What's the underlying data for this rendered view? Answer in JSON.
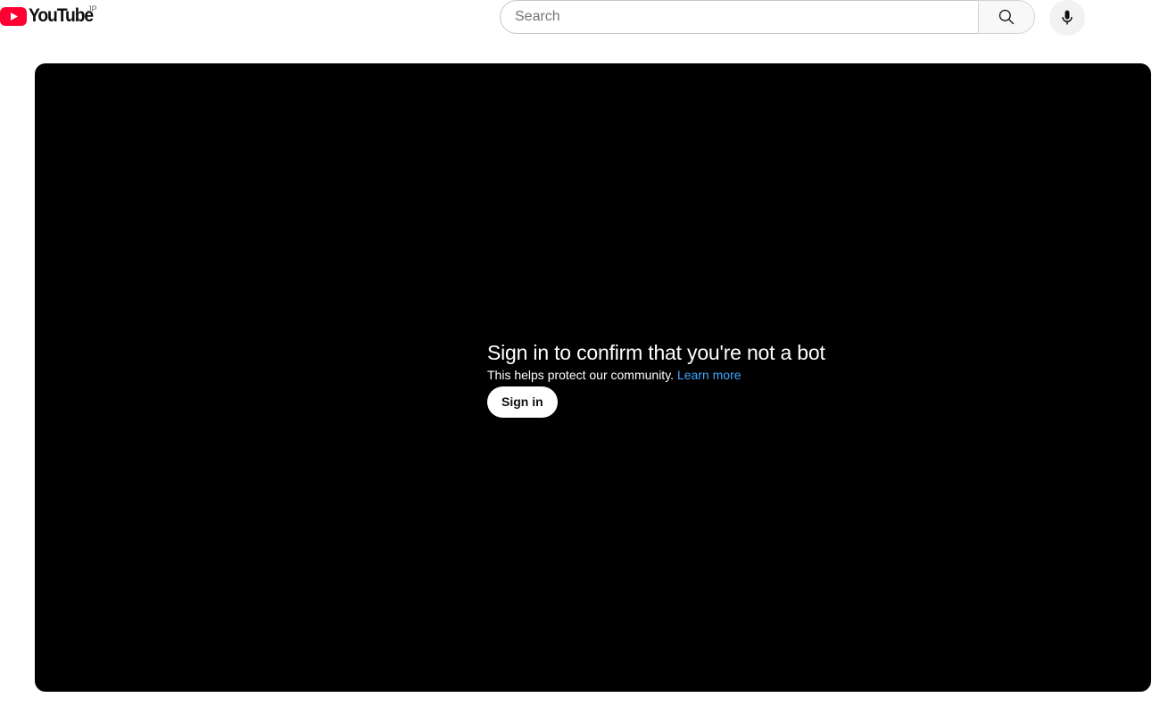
{
  "header": {
    "logo_icon": "youtube-play-icon",
    "logo_text": "YouTube",
    "country_code": "JP",
    "search": {
      "placeholder": "Search",
      "value": ""
    },
    "search_icon": "search-icon",
    "voice_icon": "microphone-icon"
  },
  "player": {
    "title": "Sign in to confirm that you're not a bot",
    "message": "This helps protect our community.",
    "link_label": "Learn more",
    "button_label": "Sign in"
  },
  "colors": {
    "brand_red": "#ff0033",
    "player_bg": "#000000",
    "link_blue": "#3ea6ff"
  }
}
